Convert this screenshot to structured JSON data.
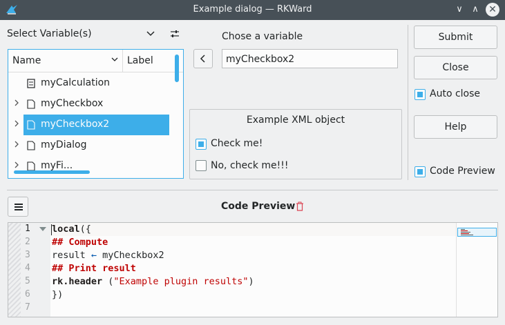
{
  "window": {
    "title": "Example dialog — RKWard",
    "minimize_glyph": "∨",
    "maximize_glyph": "∧",
    "close_glyph": "✕"
  },
  "varselector": {
    "label": "Select Variable(s)",
    "columns": {
      "name": "Name",
      "label": "Label"
    },
    "items": [
      {
        "name": "myCalculation",
        "icon": "calculation-icon",
        "expandable": false,
        "selected": false
      },
      {
        "name": "myCheckbox",
        "icon": "document-icon",
        "expandable": true,
        "selected": false
      },
      {
        "name": "myCheckbox2",
        "icon": "document-icon",
        "expandable": true,
        "selected": true
      },
      {
        "name": "myDialog",
        "icon": "document-icon",
        "expandable": true,
        "selected": false
      },
      {
        "name": "myFi...",
        "icon": "document-icon",
        "expandable": true,
        "selected": false
      }
    ]
  },
  "varslot": {
    "label": "Chose a variable",
    "value": "myCheckbox2"
  },
  "xmlgroup": {
    "title": "Example XML object",
    "checkbox1": {
      "label": "Check me!",
      "checked": true
    },
    "checkbox2": {
      "label": "No, check me!!!",
      "checked": false
    }
  },
  "buttons": {
    "submit": "Submit",
    "close": "Close",
    "auto_close": "Auto close",
    "help": "Help",
    "code_preview": "Code Preview"
  },
  "preview": {
    "title": "Code Preview",
    "line_numbers": [
      "1",
      "2",
      "3",
      "4",
      "5",
      "6",
      "7"
    ],
    "code": {
      "l1_kw": "local",
      "l1_rest": "({",
      "l2": "## Compute",
      "l3_a": "result ",
      "l3_arrow": "←",
      "l3_b": " myCheckbox2",
      "l4": "## Print result",
      "l5_kw": "rk.header",
      "l5_open": " (",
      "l5_str": "\"Example plugin results\"",
      "l5_close": ")",
      "l6": "})"
    }
  },
  "colors": {
    "accent": "#3daee9",
    "titlebar": "#475057",
    "comment": "#bf0303"
  }
}
